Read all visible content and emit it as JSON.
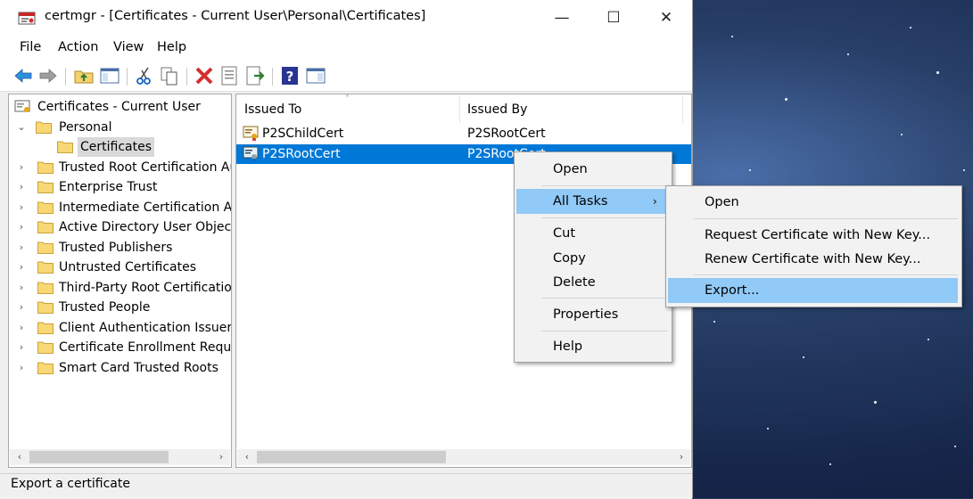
{
  "window": {
    "title": "certmgr - [Certificates - Current User\\Personal\\Certificates]",
    "minimize_glyph": "—",
    "maximize_glyph": "☐",
    "close_glyph": "✕"
  },
  "menubar": [
    "File",
    "Action",
    "View",
    "Help"
  ],
  "toolbar": [
    "back-arrow-icon",
    "forward-arrow-icon",
    "up-folder-icon",
    "show-hide-tree-icon",
    "cut-icon",
    "copy-icon",
    "delete-icon",
    "properties-icon",
    "export-list-icon",
    "help-icon",
    "show-action-pane-icon"
  ],
  "tree": {
    "root": "Certificates - Current User",
    "personal": "Personal",
    "certificates": "Certificates",
    "items": [
      "Trusted Root Certification Aut",
      "Enterprise Trust",
      "Intermediate Certification Aut",
      "Active Directory User Object",
      "Trusted Publishers",
      "Untrusted Certificates",
      "Third-Party Root Certification",
      "Trusted People",
      "Client Authentication Issuers",
      "Certificate Enrollment Reques",
      "Smart Card Trusted Roots"
    ]
  },
  "list": {
    "columns": [
      "Issued To",
      "Issued By"
    ],
    "rows": [
      {
        "issued_to": "P2SChildCert",
        "issued_by": "P2SRootCert"
      },
      {
        "issued_to": "P2SRootCert",
        "issued_by": "P2SRootCert"
      }
    ]
  },
  "context_menu": {
    "open": "Open",
    "all_tasks": "All Tasks",
    "cut": "Cut",
    "copy": "Copy",
    "delete": "Delete",
    "properties": "Properties",
    "help": "Help"
  },
  "submenu": {
    "open": "Open",
    "request": "Request Certificate with New Key...",
    "renew": "Renew Certificate with New Key...",
    "export": "Export..."
  },
  "status": "Export a certificate",
  "colors": {
    "selection": "#0078d7",
    "menu_highlight": "#91c9f7"
  }
}
